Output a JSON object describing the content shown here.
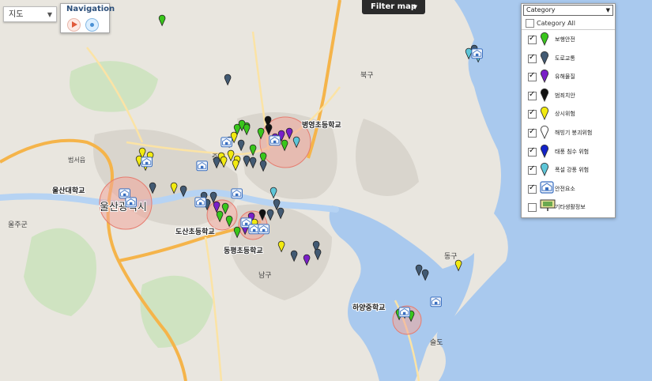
{
  "map_type": {
    "selected": "지도"
  },
  "navigation": {
    "title": "Navigation"
  },
  "filter": {
    "label": "Filter map"
  },
  "category_panel": {
    "header": "Category",
    "all_label": "Category All",
    "items": [
      {
        "label": "보행안전",
        "checked": true,
        "icon": "pin",
        "color": "#39c61b"
      },
      {
        "label": "도로교통",
        "checked": true,
        "icon": "pin",
        "color": "#425a73"
      },
      {
        "label": "유해물질",
        "checked": true,
        "icon": "pin",
        "color": "#7a1fc8"
      },
      {
        "label": "범죄치안",
        "checked": true,
        "icon": "pin",
        "color": "#111111"
      },
      {
        "label": "상시위험",
        "checked": true,
        "icon": "pin",
        "color": "#f2ea10"
      },
      {
        "label": "해빙기 붕괴위험",
        "checked": true,
        "icon": "pin",
        "color": "#ffffff"
      },
      {
        "label": "태풍 침수 위험",
        "checked": true,
        "icon": "pin",
        "color": "#1323c8"
      },
      {
        "label": "폭설 강풍 위험",
        "checked": true,
        "icon": "pin",
        "color": "#5ec6d8"
      },
      {
        "label": "안전요소",
        "checked": true,
        "icon": "building",
        "color": "#3a6fc0"
      },
      {
        "label": "기타생활정보",
        "checked": false,
        "icon": "sign",
        "color": "#e8e39a"
      }
    ]
  },
  "map_labels": [
    {
      "text": "병영초등학교",
      "kind": "school"
    },
    {
      "text": "울산대학교",
      "kind": "school"
    },
    {
      "text": "울산광역시",
      "kind": "city"
    },
    {
      "text": "도산초등학교",
      "kind": "school"
    },
    {
      "text": "동평초등학교",
      "kind": "school"
    },
    {
      "text": "하양중학교",
      "kind": "school"
    },
    {
      "text": "남구",
      "kind": "district"
    },
    {
      "text": "북구",
      "kind": "district"
    },
    {
      "text": "동구",
      "kind": "district"
    },
    {
      "text": "울주군",
      "kind": "district"
    },
    {
      "text": "중구",
      "kind": "district"
    },
    {
      "text": "범서읍",
      "kind": "district"
    },
    {
      "text": "슬도",
      "kind": "place"
    }
  ],
  "map_colors": {
    "land": "#e9e6df",
    "sea": "#a9c9ee",
    "river": "#b6d3f3",
    "road": "#f5b44a",
    "urban": "#d7d3ca"
  }
}
